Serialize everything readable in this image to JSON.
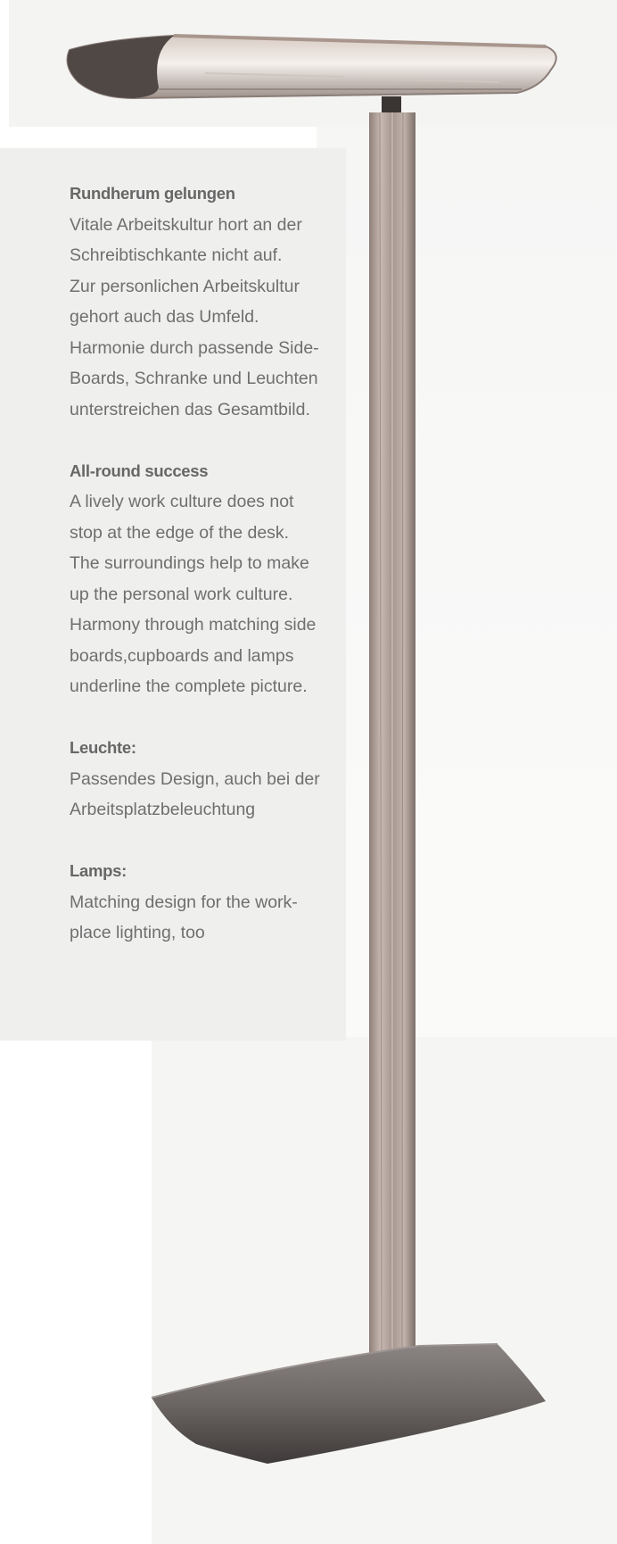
{
  "sections": [
    {
      "heading": "Rundherum gelungen",
      "lines": [
        "Vitale Arbeitskultur hort an der",
        "Schreibtischkante  nicht auf.",
        "Zur personlichen Arbeitskultur",
        "gehort auch das Umfeld.",
        "Harmonie durch passende Side-",
        "Boards, Schranke und Leuchten",
        "unterstreichen das Gesamtbild."
      ]
    },
    {
      "heading": "All-round success",
      "lines": [
        "A lively work culture does not",
        "stop at the edge of the desk.",
        "The surroundings help to make",
        "up the personal work culture.",
        "Harmony through matching side",
        "boards,cupboards and lamps",
        "underline the complete picture."
      ]
    },
    {
      "heading": "Leuchte:",
      "lines": [
        "Passendes Design, auch bei der",
        "Arbeitsplatzbeleuchtung"
      ]
    },
    {
      "heading": "Lamps:",
      "lines": [
        "Matching design for the work-",
        "place lighting, too"
      ]
    }
  ],
  "colors": {
    "text": "#6f6f6f",
    "heading": "#676767",
    "panel": "#efefee",
    "lamp_metal": "#b9aaa2",
    "lamp_base": "#6b6563"
  },
  "image": {
    "subject": "floor-lamp"
  }
}
